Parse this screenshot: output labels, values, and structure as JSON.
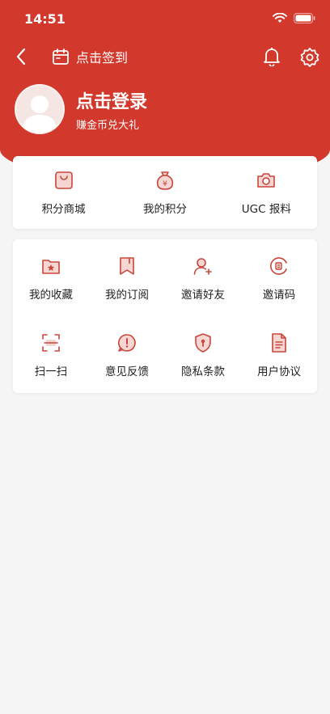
{
  "status_bar": {
    "time": "14:51"
  },
  "nav": {
    "checkin_label": "点击签到"
  },
  "profile": {
    "title": "点击登录",
    "subtitle": "赚金币兑大礼"
  },
  "top_menu": [
    {
      "label": "积分商城",
      "icon": "shopping-bag-icon"
    },
    {
      "label": "我的积分",
      "icon": "money-bag-icon"
    },
    {
      "label": "UGC 报料",
      "icon": "camera-icon"
    }
  ],
  "tools_menu": [
    {
      "label": "我的收藏",
      "icon": "favorites-folder-icon"
    },
    {
      "label": "我的订阅",
      "icon": "bookmark-icon"
    },
    {
      "label": "邀请好友",
      "icon": "add-friend-icon"
    },
    {
      "label": "邀请码",
      "icon": "invite-code-icon"
    },
    {
      "label": "扫一扫",
      "icon": "scan-icon"
    },
    {
      "label": "意见反馈",
      "icon": "feedback-icon"
    },
    {
      "label": "隐私条款",
      "icon": "privacy-shield-icon"
    },
    {
      "label": "用户协议",
      "icon": "document-icon"
    }
  ],
  "colors": {
    "brand": "#d3382c",
    "icon_red": "#c8463b",
    "background": "#f5f5f5"
  }
}
